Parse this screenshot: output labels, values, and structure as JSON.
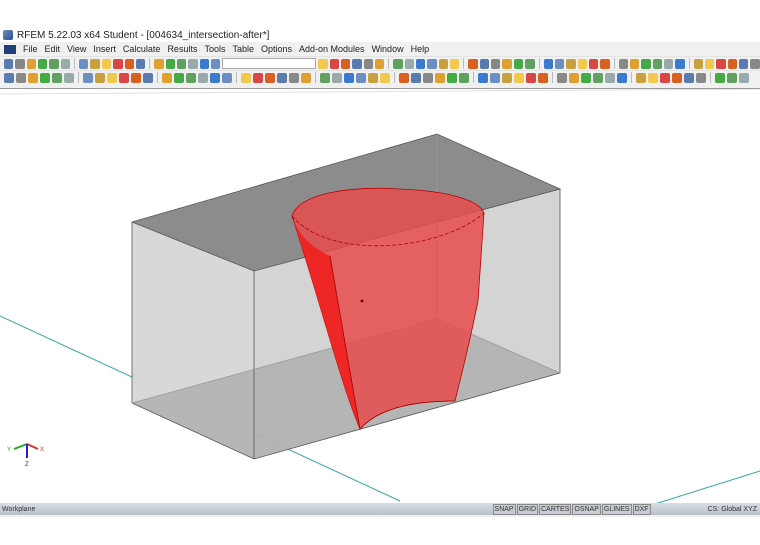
{
  "title": "RFEM 5.22.03 x64 Student - [004634_intersection-after*]",
  "menu": [
    "File",
    "Edit",
    "View",
    "Insert",
    "Calculate",
    "Results",
    "Tools",
    "Table",
    "Options",
    "Add-on Modules",
    "Window",
    "Help"
  ],
  "toolbar": {
    "combo_value": ""
  },
  "axes": {
    "x": "X",
    "y": "Y",
    "z": "Z"
  },
  "status": {
    "left": "Workplane",
    "toggles": [
      "SNAP",
      "GRID",
      "CARTES",
      "OSNAP",
      "GLINES",
      "DXF"
    ],
    "cs": "CS: Global XYZ"
  },
  "colors": {
    "surface": "#e84c4c",
    "box": "#a8a8a8",
    "workplane": "#3aa6a6"
  }
}
